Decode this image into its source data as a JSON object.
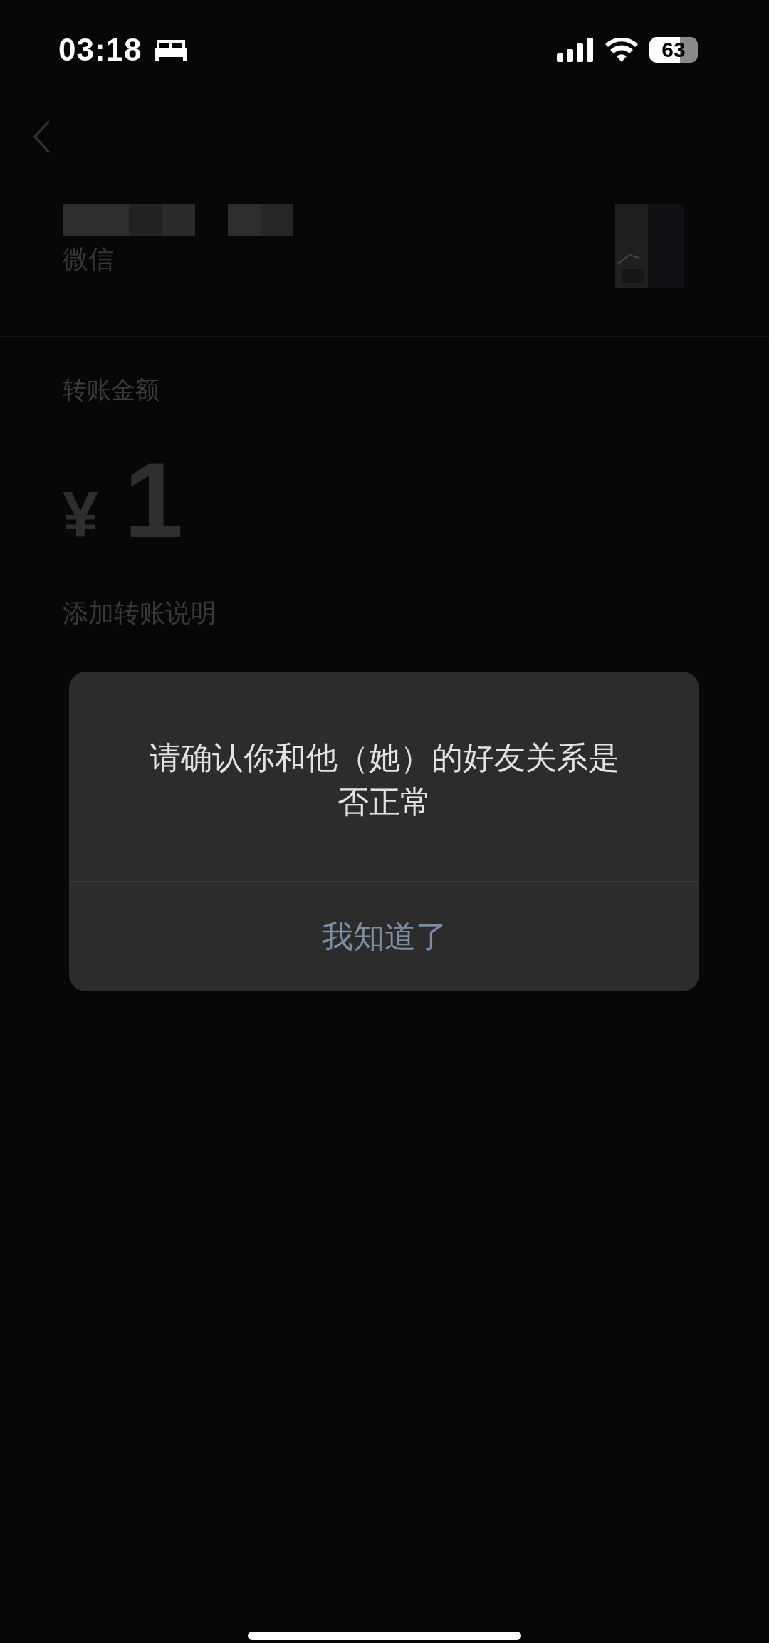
{
  "status_bar": {
    "time": "03:18",
    "battery": "63"
  },
  "recipient": {
    "wechat_id": "微信"
  },
  "amount": {
    "label": "转账金额",
    "currency": "¥",
    "value": "1"
  },
  "note_link": "添加转账说明",
  "dialog": {
    "message": "请确认你和他（她）的好友关系是否正常",
    "button": "我知道了"
  }
}
